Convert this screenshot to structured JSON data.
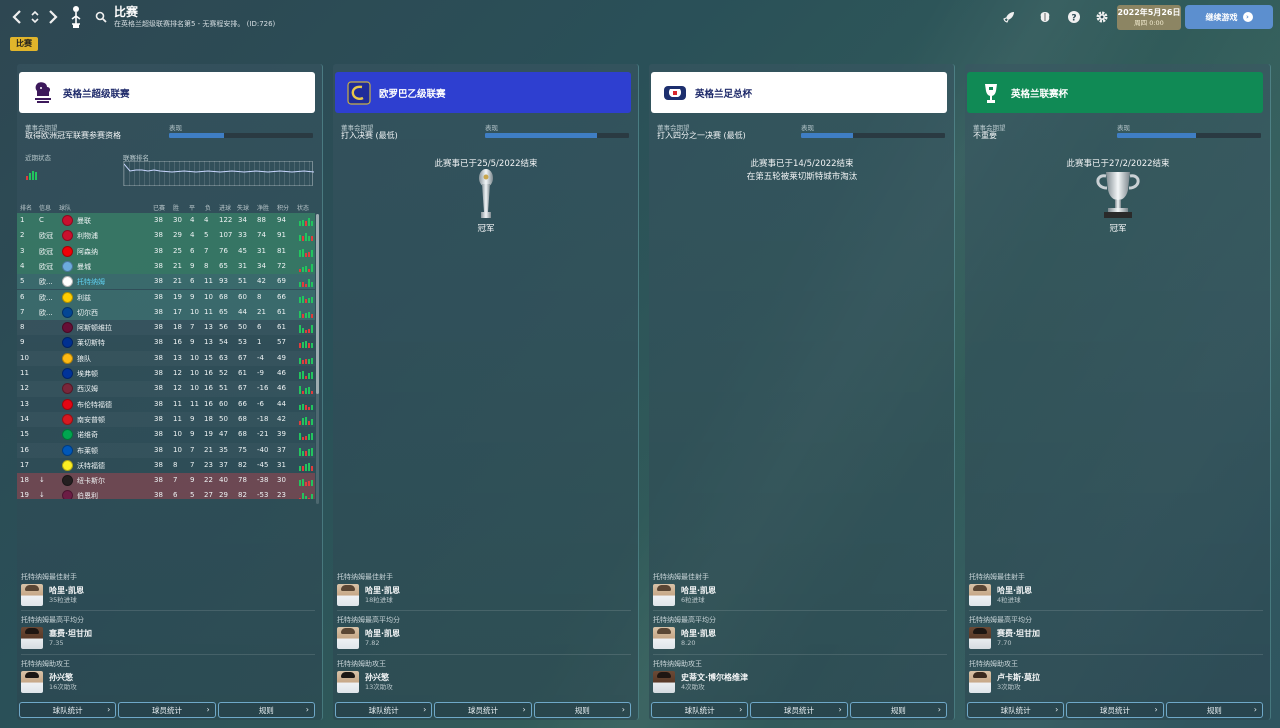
{
  "header": {
    "title": "比赛",
    "subtitle": "在英格兰超级联赛排名第5 - 无赛程安排。 (ID:726)",
    "date": "2022年5月26日",
    "weekday": "周四 0:00",
    "continue_label": "继续游戏"
  },
  "tab_label": "比赛",
  "colors": {
    "accent_yellow": "#e1b52b",
    "continue_blue": "#5c8fcf",
    "el_blue": "#2e3fd0",
    "carabao_green": "#108a55"
  },
  "panels": [
    {
      "name": "英格兰超级联赛",
      "board_label": "董事会期望",
      "board_value": "取得欧洲冠军联赛参赛资格",
      "perf_label": "表现",
      "perf_fill": 0.38,
      "form_label": "近期状态",
      "rank_label": "联赛排名",
      "table_headers": [
        "排名",
        "信息",
        "球队",
        "已赛",
        "胜",
        "平",
        "负",
        "进球",
        "失球",
        "净胜",
        "积分",
        "状态"
      ],
      "table_rows": [
        {
          "pos": "1",
          "info": "C",
          "team": "曼联",
          "p": "38",
          "w": "30",
          "d": "4",
          "l": "4",
          "gf": "122",
          "ga": "34",
          "gd": "88",
          "pts": "94"
        },
        {
          "pos": "2",
          "info": "欧冠",
          "team": "利物浦",
          "p": "38",
          "w": "29",
          "d": "4",
          "l": "5",
          "gf": "107",
          "ga": "33",
          "gd": "74",
          "pts": "91"
        },
        {
          "pos": "3",
          "info": "欧冠",
          "team": "阿森纳",
          "p": "38",
          "w": "25",
          "d": "6",
          "l": "7",
          "gf": "76",
          "ga": "45",
          "gd": "31",
          "pts": "81"
        },
        {
          "pos": "4",
          "info": "欧冠",
          "team": "曼城",
          "p": "38",
          "w": "21",
          "d": "9",
          "l": "8",
          "gf": "65",
          "ga": "31",
          "gd": "34",
          "pts": "72"
        },
        {
          "pos": "5",
          "info": "欧...",
          "team": "托特纳姆",
          "p": "38",
          "w": "21",
          "d": "6",
          "l": "11",
          "gf": "93",
          "ga": "51",
          "gd": "42",
          "pts": "69"
        },
        {
          "pos": "6",
          "info": "欧...",
          "team": "利兹",
          "p": "38",
          "w": "19",
          "d": "9",
          "l": "10",
          "gf": "68",
          "ga": "60",
          "gd": "8",
          "pts": "66"
        },
        {
          "pos": "7",
          "info": "欧...",
          "team": "切尔西",
          "p": "38",
          "w": "17",
          "d": "10",
          "l": "11",
          "gf": "65",
          "ga": "44",
          "gd": "21",
          "pts": "61"
        },
        {
          "pos": "8",
          "info": "",
          "team": "阿斯顿维拉",
          "p": "38",
          "w": "18",
          "d": "7",
          "l": "13",
          "gf": "56",
          "ga": "50",
          "gd": "6",
          "pts": "61"
        },
        {
          "pos": "9",
          "info": "",
          "team": "莱切斯特",
          "p": "38",
          "w": "16",
          "d": "9",
          "l": "13",
          "gf": "54",
          "ga": "53",
          "gd": "1",
          "pts": "57"
        },
        {
          "pos": "10",
          "info": "",
          "team": "狼队",
          "p": "38",
          "w": "13",
          "d": "10",
          "l": "15",
          "gf": "63",
          "ga": "67",
          "gd": "-4",
          "pts": "49"
        },
        {
          "pos": "11",
          "info": "",
          "team": "埃弗顿",
          "p": "38",
          "w": "12",
          "d": "10",
          "l": "16",
          "gf": "52",
          "ga": "61",
          "gd": "-9",
          "pts": "46"
        },
        {
          "pos": "12",
          "info": "",
          "team": "西汉姆",
          "p": "38",
          "w": "12",
          "d": "10",
          "l": "16",
          "gf": "51",
          "ga": "67",
          "gd": "-16",
          "pts": "46"
        },
        {
          "pos": "13",
          "info": "",
          "team": "布伦特福德",
          "p": "38",
          "w": "11",
          "d": "11",
          "l": "16",
          "gf": "60",
          "ga": "66",
          "gd": "-6",
          "pts": "44"
        },
        {
          "pos": "14",
          "info": "",
          "team": "南安普顿",
          "p": "38",
          "w": "11",
          "d": "9",
          "l": "18",
          "gf": "50",
          "ga": "68",
          "gd": "-18",
          "pts": "42"
        },
        {
          "pos": "15",
          "info": "",
          "team": "诺维奇",
          "p": "38",
          "w": "10",
          "d": "9",
          "l": "19",
          "gf": "47",
          "ga": "68",
          "gd": "-21",
          "pts": "39"
        },
        {
          "pos": "16",
          "info": "",
          "team": "布莱顿",
          "p": "38",
          "w": "10",
          "d": "7",
          "l": "21",
          "gf": "35",
          "ga": "75",
          "gd": "-40",
          "pts": "37"
        },
        {
          "pos": "17",
          "info": "",
          "team": "沃特福德",
          "p": "38",
          "w": "8",
          "d": "7",
          "l": "23",
          "gf": "37",
          "ga": "82",
          "gd": "-45",
          "pts": "31"
        },
        {
          "pos": "18",
          "info": "↓",
          "team": "纽卡斯尔",
          "p": "38",
          "w": "7",
          "d": "9",
          "l": "22",
          "gf": "40",
          "ga": "78",
          "gd": "-38",
          "pts": "30"
        },
        {
          "pos": "19",
          "info": "↓",
          "team": "伯恩利",
          "p": "38",
          "w": "6",
          "d": "5",
          "l": "27",
          "gf": "29",
          "ga": "82",
          "gd": "-53",
          "pts": "23"
        }
      ],
      "scorer_title": "托特纳姆最佳射手",
      "scorer_name": "哈里·凯恩",
      "scorer_stat": "35粒进球",
      "rating_title": "托特纳姆最高平均分",
      "rating_name": "塞费·坦甘加",
      "rating_stat": "7.35",
      "assist_title": "托特纳姆助攻王",
      "assist_name": "孙兴慜",
      "assist_stat": "16次助攻",
      "btn_team": "球队统计",
      "btn_player": "球员统计",
      "btn_rules": "规则"
    },
    {
      "name": "欧罗巴乙级联赛",
      "board_label": "董事会期望",
      "board_value": "打入决赛 (最低)",
      "perf_label": "表现",
      "perf_fill": 0.78,
      "ended_text": "此赛事已于25/5/2022结束",
      "result_text": "冠军",
      "scorer_title": "托特纳姆最佳射手",
      "scorer_name": "哈里·凯恩",
      "scorer_stat": "18粒进球",
      "rating_title": "托特纳姆最高平均分",
      "rating_name": "哈里·凯恩",
      "rating_stat": "7.82",
      "assist_title": "托特纳姆助攻王",
      "assist_name": "孙兴慜",
      "assist_stat": "13次助攻",
      "btn_team": "球队统计",
      "btn_player": "球员统计",
      "btn_rules": "规则"
    },
    {
      "name": "英格兰足总杯",
      "board_label": "董事会期望",
      "board_value": "打入四分之一决赛 (最低)",
      "perf_label": "表现",
      "perf_fill": 0.36,
      "ended_text": "此赛事已于14/5/2022结束",
      "result_text": "在第五轮被莱切斯特城市淘汰",
      "scorer_title": "托特纳姆最佳射手",
      "scorer_name": "哈里·凯恩",
      "scorer_stat": "6粒进球",
      "rating_title": "托特纳姆最高平均分",
      "rating_name": "哈里·凯恩",
      "rating_stat": "8.20",
      "assist_title": "托特纳姆助攻王",
      "assist_name": "史蒂文·博尔格维津",
      "assist_stat": "4次助攻",
      "btn_team": "球队统计",
      "btn_player": "球员统计",
      "btn_rules": "规则"
    },
    {
      "name": "英格兰联赛杯",
      "board_label": "董事会期望",
      "board_value": "不重要",
      "perf_label": "表现",
      "perf_fill": 0.55,
      "ended_text": "此赛事已于27/2/2022结束",
      "result_text": "冠军",
      "scorer_title": "托特纳姆最佳射手",
      "scorer_name": "哈里·凯恩",
      "scorer_stat": "4粒进球",
      "rating_title": "托特纳姆最高平均分",
      "rating_name": "赛费·坦甘加",
      "rating_stat": "7.70",
      "assist_title": "托特纳姆助攻王",
      "assist_name": "卢卡斯·莫拉",
      "assist_stat": "3次助攻",
      "btn_team": "球队统计",
      "btn_player": "球员统计",
      "btn_rules": "规则"
    }
  ]
}
